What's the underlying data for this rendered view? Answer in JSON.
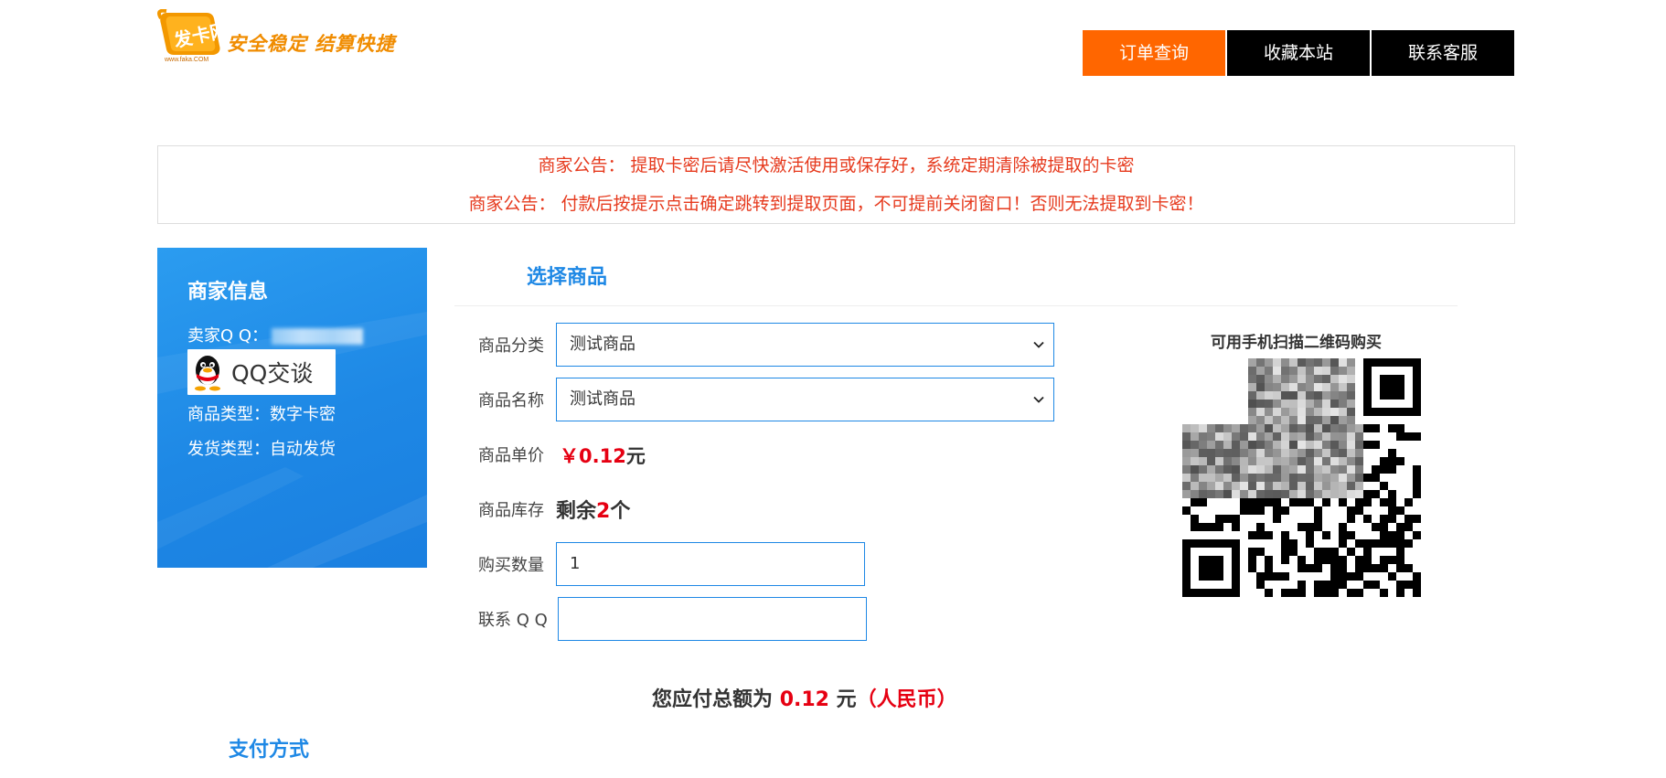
{
  "header": {
    "logo_text": "发卡网",
    "slogan": "安全稳定 结算快捷",
    "logo_url": "www.faka.COM",
    "nav": [
      {
        "label": "订单查询",
        "active": true
      },
      {
        "label": "收藏本站",
        "active": false
      },
      {
        "label": "联系客服",
        "active": false
      }
    ]
  },
  "notice": {
    "lines": [
      "商家公告： 提取卡密后请尽快激活使用或保存好，系统定期清除被提取的卡密",
      "商家公告： 付款后按提示点击确定跳转到提取页面，不可提前关闭窗口！否则无法提取到卡密！"
    ]
  },
  "merchant": {
    "title": "商家信息",
    "qq_label": "卖家Q Q：",
    "qq_button": "QQ交谈",
    "product_type": "商品类型：数字卡密",
    "delivery_type": "发货类型：自动发货"
  },
  "product": {
    "section_title": "选择商品",
    "category_label": "商品分类",
    "category_value": "测试商品",
    "name_label": "商品名称",
    "name_value": "测试商品",
    "price_label": "商品单价",
    "price_symbol": "￥",
    "price_value": "0.12",
    "price_unit": "元",
    "stock_label": "商品库存",
    "stock_prefix": "剩余",
    "stock_count": "2",
    "stock_suffix": "个",
    "quantity_label": "购买数量",
    "quantity_value": "1",
    "contact_label": "联系 Q Q",
    "contact_value": ""
  },
  "qr": {
    "caption": "可用手机扫描二维码购买"
  },
  "total": {
    "prefix": "您应付总额为",
    "amount": "0.12",
    "unit": "元",
    "currency": "（人民币）"
  },
  "payment": {
    "title": "支付方式"
  },
  "colors": {
    "accent": "#ff6600",
    "blue": "#1e88e5",
    "notice_red": "#e63a1e",
    "price_red": "#e60012"
  }
}
